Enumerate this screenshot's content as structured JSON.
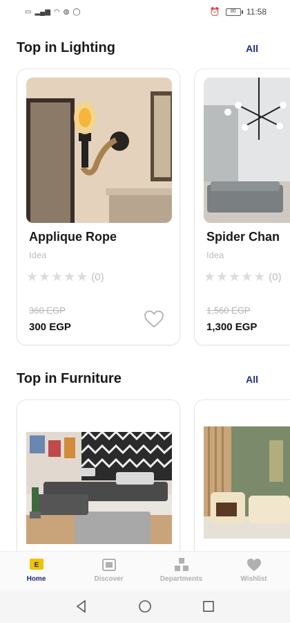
{
  "status_bar": {
    "left_icons": [
      "sim-icon",
      "signal-icon",
      "wifi-icon",
      "data-icon",
      "whatsapp-icon"
    ],
    "battery": "80",
    "time": "11:58"
  },
  "sections": [
    {
      "title": "Top in Lighting",
      "all_label": "All",
      "products": [
        {
          "name": "Applique Rope",
          "brand": "Idea",
          "rating_count": "(0)",
          "old_price": "360 EGP",
          "price": "300 EGP"
        },
        {
          "name": "Spider Chan",
          "brand": "Idea",
          "rating_count": "(0)",
          "old_price": "1,560 EGP",
          "price": "1,300 EGP"
        }
      ]
    },
    {
      "title": "Top in Furniture",
      "all_label": "All",
      "products": [
        {
          "name": "",
          "brand": "",
          "rating_count": "",
          "old_price": "",
          "price": ""
        },
        {
          "name": "",
          "brand": "",
          "rating_count": "",
          "old_price": "",
          "price": ""
        }
      ]
    }
  ],
  "bottom_nav": {
    "items": [
      {
        "label": "Home",
        "icon": "home-cart-icon",
        "active": true
      },
      {
        "label": "Discover",
        "icon": "discover-icon",
        "active": false
      },
      {
        "label": "Departments",
        "icon": "departments-icon",
        "active": false
      },
      {
        "label": "Wishlist",
        "icon": "wishlist-icon",
        "active": false
      }
    ]
  },
  "colors": {
    "accent": "#1c2a84",
    "active_icon": "#f2c200",
    "muted": "#bdbdbd"
  }
}
